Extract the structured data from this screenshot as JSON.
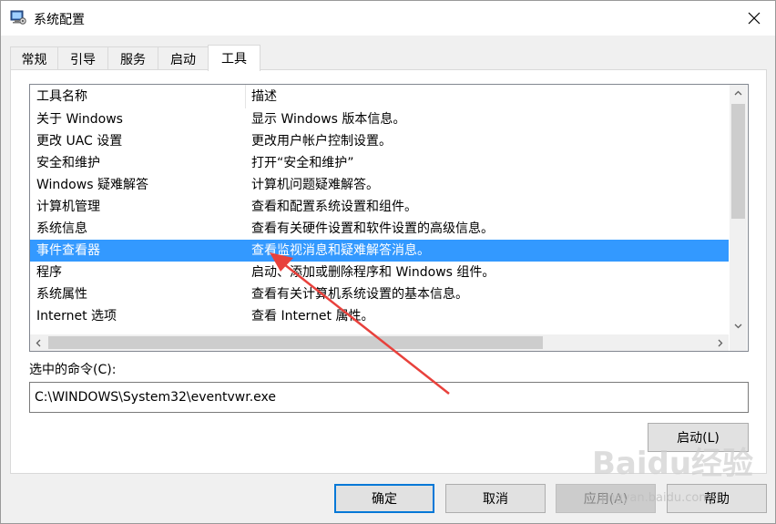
{
  "window": {
    "title": "系统配置"
  },
  "tabs": [
    {
      "label": "常规",
      "active": false
    },
    {
      "label": "引导",
      "active": false
    },
    {
      "label": "服务",
      "active": false
    },
    {
      "label": "启动",
      "active": false
    },
    {
      "label": "工具",
      "active": true
    }
  ],
  "list": {
    "columns": [
      "工具名称",
      "描述"
    ],
    "rows": [
      {
        "name": "关于 Windows",
        "desc": "显示 Windows 版本信息。"
      },
      {
        "name": "更改 UAC 设置",
        "desc": "更改用户帐户控制设置。"
      },
      {
        "name": "安全和维护",
        "desc": "打开“安全和维护”"
      },
      {
        "name": "Windows 疑难解答",
        "desc": "计算机问题疑难解答。"
      },
      {
        "name": "计算机管理",
        "desc": "查看和配置系统设置和组件。"
      },
      {
        "name": "系统信息",
        "desc": "查看有关硬件设置和软件设置的高级信息。"
      },
      {
        "name": "事件查看器",
        "desc": "查看监视消息和疑难解答消息。",
        "selected": true
      },
      {
        "name": "程序",
        "desc": "启动、添加或删除程序和 Windows 组件。"
      },
      {
        "name": "系统属性",
        "desc": "查看有关计算机系统设置的基本信息。"
      },
      {
        "name": "Internet 选项",
        "desc": "查看 Internet 属性。"
      },
      {
        "name": "",
        "desc": ""
      }
    ]
  },
  "command": {
    "label": "选中的命令(C):",
    "value": "C:\\WINDOWS\\System32\\eventvwr.exe"
  },
  "buttons": {
    "launch": "启动(L)",
    "ok": "确定",
    "cancel": "取消",
    "apply": "应用(A)",
    "help": "帮助"
  },
  "watermark": {
    "text": "Baidu经验",
    "url": "jingyan.baidu.com"
  },
  "colors": {
    "selection": "#3399ff",
    "annotation_arrow": "#e8413c",
    "default_button_border": "#0078d7"
  }
}
